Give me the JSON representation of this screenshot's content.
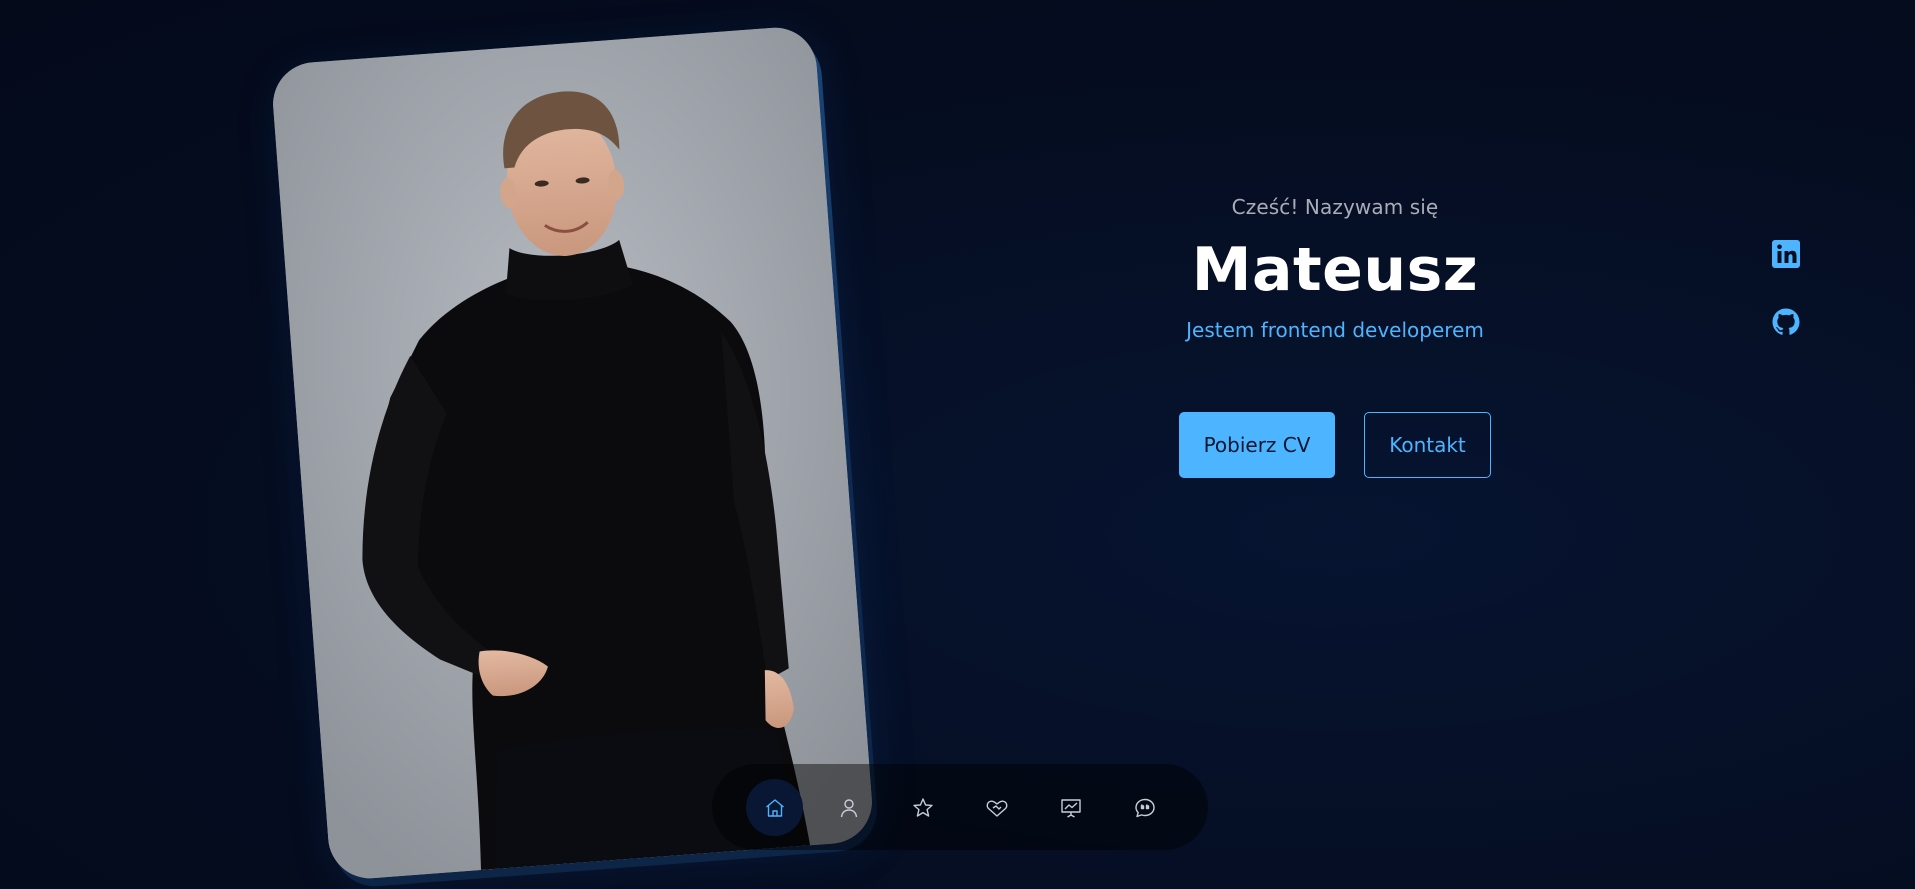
{
  "hero": {
    "greeting": "Cześć! Nazywam się",
    "name": "Mateusz",
    "role": "Jestem frontend developerem"
  },
  "buttons": {
    "download_cv": "Pobierz CV",
    "contact": "Kontakt"
  },
  "socials": [
    {
      "icon": "linkedin-icon"
    },
    {
      "icon": "github-icon"
    }
  ],
  "nav": {
    "items": [
      {
        "icon": "home-icon",
        "active": true
      },
      {
        "icon": "user-icon",
        "active": false
      },
      {
        "icon": "star-icon",
        "active": false
      },
      {
        "icon": "handshake-icon",
        "active": false
      },
      {
        "icon": "presentation-icon",
        "active": false
      },
      {
        "icon": "chat-quote-icon",
        "active": false
      }
    ]
  },
  "colors": {
    "background": "#050d21",
    "accent": "#4db5ff",
    "name": "#ffffff",
    "greeting": "#a9adb8"
  }
}
